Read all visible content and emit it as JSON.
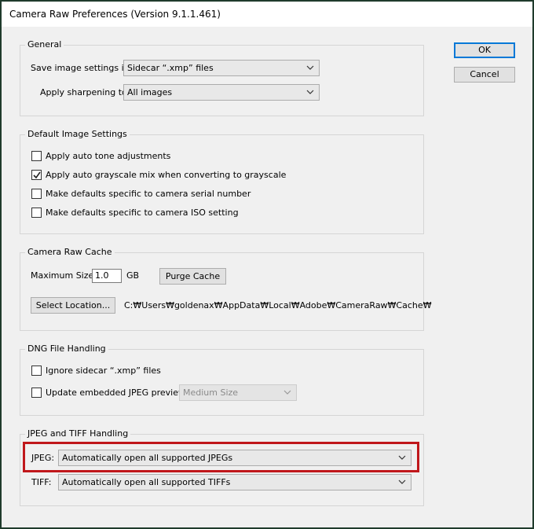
{
  "window": {
    "title": "Camera Raw Preferences  (Version 9.1.1.461)"
  },
  "buttons": {
    "ok": "OK",
    "cancel": "Cancel"
  },
  "general": {
    "legend": "General",
    "save_settings_label": "Save image settings in:",
    "save_settings_value": "Sidecar “.xmp” files",
    "sharpening_label": "Apply sharpening to:",
    "sharpening_value": "All images"
  },
  "default_image_settings": {
    "legend": "Default Image Settings",
    "options": [
      {
        "label": "Apply auto tone adjustments",
        "checked": false
      },
      {
        "label": "Apply auto grayscale mix when converting to grayscale",
        "checked": true
      },
      {
        "label": "Make defaults specific to camera serial number",
        "checked": false
      },
      {
        "label": "Make defaults specific to camera ISO setting",
        "checked": false
      }
    ]
  },
  "cache": {
    "legend": "Camera Raw Cache",
    "max_size_label": "Maximum Size:",
    "max_size_value": "1.0",
    "unit": "GB",
    "purge_label": "Purge Cache",
    "select_location_label": "Select Location...",
    "path": "C:₩Users₩goldenax₩AppData₩Local₩Adobe₩CameraRaw₩Cache₩"
  },
  "dng": {
    "legend": "DNG File Handling",
    "ignore_sidecar_label": "Ignore sidecar “.xmp” files",
    "ignore_sidecar_checked": false,
    "update_previews_label": "Update embedded JPEG previews:",
    "update_previews_checked": false,
    "preview_size_value": "Medium Size"
  },
  "jpeg_tiff": {
    "legend": "JPEG and TIFF Handling",
    "jpeg_label": "JPEG:",
    "jpeg_value": "Automatically open all supported JPEGs",
    "tiff_label": "TIFF:",
    "tiff_value": "Automatically open all supported TIFFs"
  },
  "colors": {
    "highlight": "#c0171b",
    "default_button_border": "#0078d7"
  }
}
